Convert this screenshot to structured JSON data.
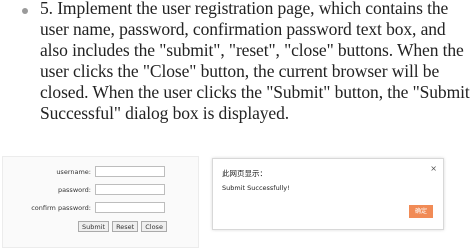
{
  "instruction": {
    "text": "5. Implement the user registration page, which contains the user name, password, confirmation password text box, and also includes the \"submit\", \"reset\", \"close\" buttons. When the user clicks the \"Close\" button, the current browser will be closed. When the user clicks the \"Submit\" button, the \"Submit Successful\" dialog box is displayed."
  },
  "form": {
    "username_label": "username:",
    "password_label": "password:",
    "confirm_label": "confirm password:",
    "submit_label": "Submit",
    "reset_label": "Reset",
    "close_label": "Close"
  },
  "dialog": {
    "title": "此网页显示：",
    "message": "Submit Successfully!",
    "ok_label": "确定",
    "close_glyph": "×"
  }
}
